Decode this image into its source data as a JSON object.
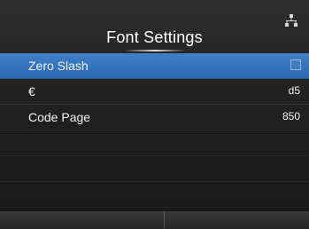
{
  "header": {
    "title": "Font Settings",
    "network_icon": "network-icon"
  },
  "menu": {
    "items": [
      {
        "label": "Zero Slash",
        "value": "",
        "kind": "checkbox",
        "checked": false,
        "selected": true
      },
      {
        "label": "€",
        "value": "d5",
        "kind": "value",
        "selected": false
      },
      {
        "label": "Code Page",
        "value": "850",
        "kind": "value",
        "selected": false
      }
    ]
  },
  "softkeys": {
    "left_label": "",
    "right_label": ""
  },
  "colors": {
    "selection": "#2f72bd",
    "background": "#1e1e1e",
    "text": "#f2f2f2"
  }
}
